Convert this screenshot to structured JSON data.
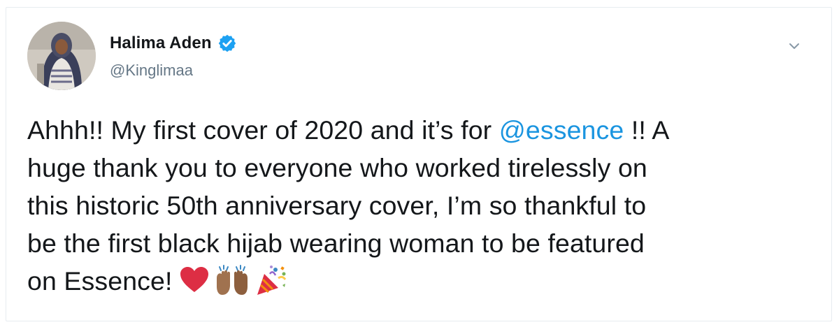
{
  "tweet": {
    "author": {
      "display_name": "Halima Aden",
      "handle": "@Kinglimaa",
      "verified": true
    },
    "lines": [
      {
        "before": "Ahhh!! My first cover of 2020 and it’s for ",
        "mention": "@essence",
        "after": " !! A"
      },
      {
        "text": "huge thank you to everyone who worked tirelessly on"
      },
      {
        "text": "this historic 50th anniversary cover, I’m so thankful to"
      },
      {
        "text": "be the first black hijab wearing woman to be featured"
      },
      {
        "text": "on Essence!"
      }
    ],
    "emojis": [
      "red-heart",
      "raising-hands-medium-dark-skin",
      "party-popper"
    ]
  },
  "colors": {
    "text": "#14171a",
    "secondary": "#657786",
    "link": "#1b95e0",
    "verified": "#1da1f2",
    "border": "#e6ecf0"
  },
  "icons": {
    "verified": "verified-badge-icon",
    "menu": "chevron-down-icon"
  }
}
